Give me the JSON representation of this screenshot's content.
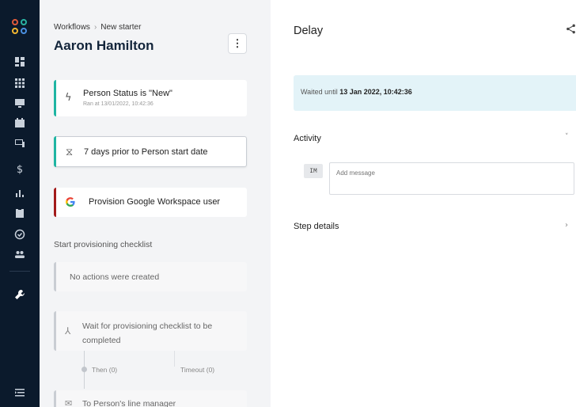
{
  "sidebar": {
    "logo_colors": [
      "#e05a3a",
      "#2ab3a3",
      "#f2b630",
      "#4a90e2"
    ],
    "items": [
      {
        "icon": "dashboard-icon"
      },
      {
        "icon": "grid-icon"
      },
      {
        "icon": "monitor-icon"
      },
      {
        "icon": "calendar-icon"
      },
      {
        "icon": "devices-icon"
      },
      {
        "icon": "dollar-icon"
      },
      {
        "icon": "bar-chart-icon"
      },
      {
        "icon": "clipboard-icon"
      },
      {
        "icon": "check-circle-icon"
      },
      {
        "icon": "people-icon"
      },
      {
        "icon": "wrench-icon"
      },
      {
        "icon": "menu-collapse-icon"
      }
    ]
  },
  "breadcrumb": {
    "root": "Workflows",
    "separator": "›",
    "current": "New starter"
  },
  "title": "Aaron Hamilton",
  "kebab_label": "⋮",
  "steps": [
    {
      "icon": "lightning-icon",
      "title": "Person Status is \"New\"",
      "subtitle": "Ran at 13/01/2022, 10:42:36",
      "accent": "#1fb5a3"
    },
    {
      "icon": "hourglass-icon",
      "title": "7 days prior to Person start date",
      "accent": "#1fb5a3"
    },
    {
      "icon": "google-icon",
      "title": "Provision Google Workspace user",
      "accent": "#a31b1b"
    }
  ],
  "checklist": {
    "section_label": "Start provisioning checklist",
    "empty_text": "No actions were created",
    "wait_text": "Wait for provisioning checklist to be completed",
    "then_label": "Then (0)",
    "timeout_label": "Timeout (0)",
    "next_text": "To Person's line manager"
  },
  "detail": {
    "title": "Delay",
    "waited_prefix": "Waited until ",
    "waited_value": "13 Jan 2022, 10:42:36",
    "activity_label": "Activity",
    "avatar_initials": "IM",
    "message_placeholder": "Add message",
    "step_details_label": "Step details",
    "chevron_down": "˅",
    "chevron_right": "›"
  }
}
